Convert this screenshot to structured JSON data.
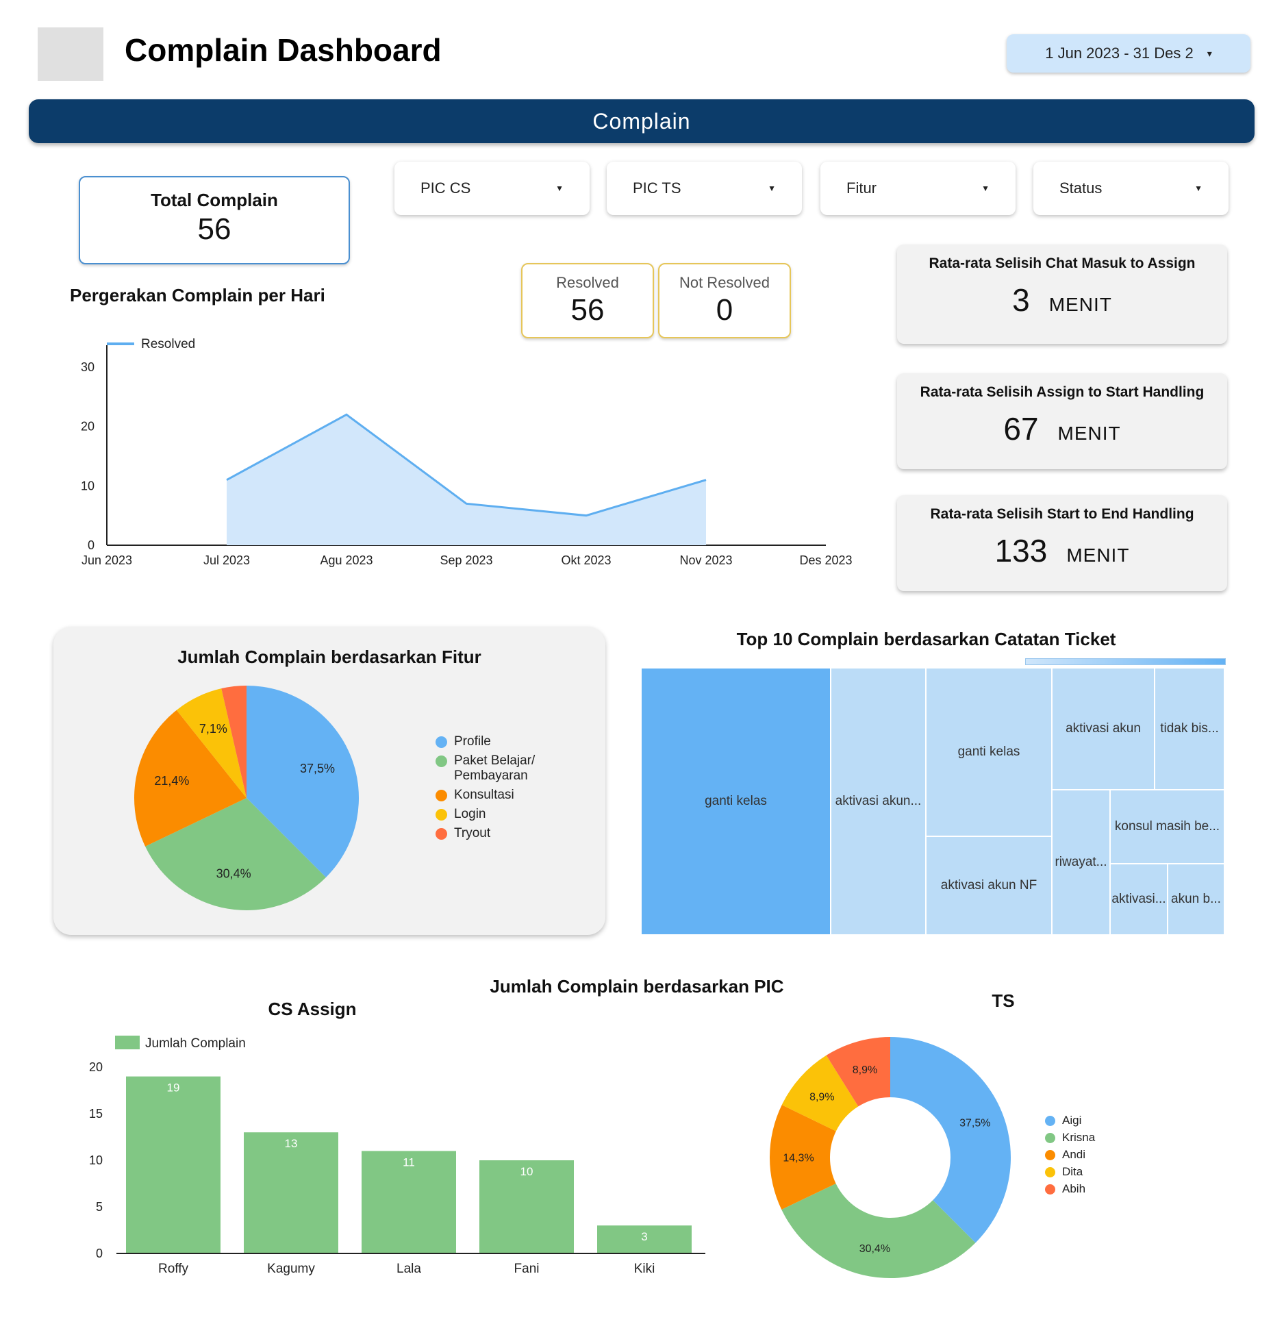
{
  "header": {
    "title": "Complain Dashboard",
    "date_range": "1 Jun 2023 - 31 Des 2",
    "caret": "▾"
  },
  "banner": {
    "label": "Complain"
  },
  "total": {
    "label": "Total Complain",
    "value": "56"
  },
  "filters": [
    {
      "label": "PIC CS",
      "caret": "▼"
    },
    {
      "label": "PIC TS",
      "caret": "▼"
    },
    {
      "label": "Fitur",
      "caret": "▼"
    },
    {
      "label": "Status",
      "caret": "▼"
    }
  ],
  "status_cards": [
    {
      "label": "Resolved",
      "value": "56"
    },
    {
      "label": "Not Resolved",
      "value": "0"
    }
  ],
  "metrics": [
    {
      "label": "Rata-rata Selisih Chat Masuk to Assign",
      "value": "3",
      "unit": "MENIT"
    },
    {
      "label": "Rata-rata Selisih Assign to Start Handling",
      "value": "67",
      "unit": "MENIT"
    },
    {
      "label": "Rata-rata Selisih Start to End Handling",
      "value": "133",
      "unit": "MENIT"
    }
  ],
  "colors": {
    "line": "#5eaef0",
    "area": "#d2e7fb",
    "bar": "#81c784",
    "blue": "#64b2f4",
    "green": "#81c784",
    "orange": "#fb8c00",
    "yellow": "#fbc208",
    "red": "#ff6d3f"
  },
  "chart_data": [
    {
      "type": "area",
      "title": "Pergerakan Complain per Hari",
      "series": [
        {
          "name": "Resolved",
          "values": [
            null,
            11,
            22,
            7,
            5,
            11,
            null
          ]
        }
      ],
      "categories": [
        "Jun 2023",
        "Jul 2023",
        "Agu 2023",
        "Sep 2023",
        "Okt 2023",
        "Nov 2023",
        "Des 2023"
      ],
      "yticks": [
        "0",
        "10",
        "20",
        "30"
      ],
      "ylim": [
        0,
        30
      ],
      "legend": "top-left"
    },
    {
      "type": "pie",
      "title": "Jumlah Complain berdasarkan Fitur",
      "slices": [
        {
          "name": "Profile",
          "value": 37.5,
          "label": "37,5%",
          "color": "#64b2f4"
        },
        {
          "name": "Paket Belajar/ Pembayaran",
          "value": 30.4,
          "label": "30,4%",
          "color": "#81c784"
        },
        {
          "name": "Konsultasi",
          "value": 21.4,
          "label": "21,4%",
          "color": "#fb8c00"
        },
        {
          "name": "Login",
          "value": 7.1,
          "label": "7,1%",
          "color": "#fbc208"
        },
        {
          "name": "Tryout",
          "value": 3.6,
          "label": "",
          "color": "#ff6d3f"
        }
      ],
      "legend": "right"
    },
    {
      "type": "treemap",
      "title": "Top 10 Complain berdasarkan Catatan Ticket",
      "cells": [
        {
          "label": "ganti kelas",
          "shade": "dark"
        },
        {
          "label": "aktivasi akun...",
          "shade": "light"
        },
        {
          "label": "ganti kelas",
          "shade": "light"
        },
        {
          "label": "aktivasi akun NF",
          "shade": "light"
        },
        {
          "label": "aktivasi akun",
          "shade": "light"
        },
        {
          "label": "tidak bis...",
          "shade": "light"
        },
        {
          "label": "riwayat...",
          "shade": "light"
        },
        {
          "label": "konsul masih be...",
          "shade": "light"
        },
        {
          "label": "aktivasi...",
          "shade": "light"
        },
        {
          "label": "akun b...",
          "shade": "light"
        }
      ]
    },
    {
      "type": "bar",
      "title": "CS Assign",
      "categories": [
        "Roffy",
        "Kagumy",
        "Lala",
        "Fani",
        "Kiki"
      ],
      "series": [
        {
          "name": "Jumlah Complain",
          "values": [
            19,
            13,
            11,
            10,
            3
          ]
        }
      ],
      "data_labels": [
        "19",
        "13",
        "11",
        "10",
        "3"
      ],
      "yticks": [
        "0",
        "5",
        "10",
        "15",
        "20"
      ],
      "ylim": [
        0,
        20
      ],
      "legend": "top-left"
    },
    {
      "type": "pie",
      "title": "TS",
      "donut": true,
      "slices": [
        {
          "name": "Aigi",
          "value": 37.5,
          "label": "37,5%",
          "color": "#64b2f4"
        },
        {
          "name": "Krisna",
          "value": 30.4,
          "label": "30,4%",
          "color": "#81c784"
        },
        {
          "name": "Andi",
          "value": 14.3,
          "label": "14,3%",
          "color": "#fb8c00"
        },
        {
          "name": "Dita",
          "value": 8.9,
          "label": "8,9%",
          "color": "#fbc208"
        },
        {
          "name": "Abih",
          "value": 8.9,
          "label": "8,9%",
          "color": "#ff6d3f"
        }
      ],
      "legend": "right"
    }
  ],
  "pic_section_title": "Jumlah Complain berdasarkan PIC"
}
